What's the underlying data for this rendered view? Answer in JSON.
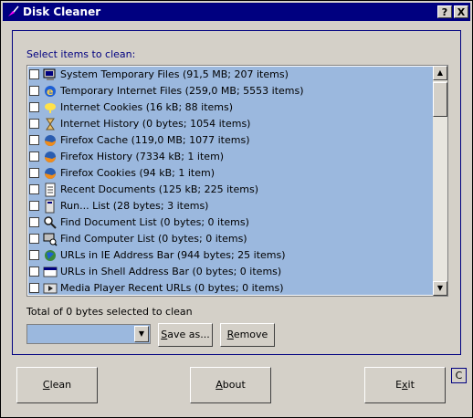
{
  "window": {
    "title": "Disk Cleaner",
    "help_button": "?",
    "close_button": "X"
  },
  "list_label": "Select items to clean:",
  "items": [
    {
      "label": "System Temporary Files (91,5 MB; 207 items)",
      "icon": "computer-icon"
    },
    {
      "label": "Temporary Internet Files (259,0 MB; 5553 items)",
      "icon": "internet-explorer-icon"
    },
    {
      "label": "Internet Cookies (16 kB; 88 items)",
      "icon": "cookie-icon"
    },
    {
      "label": "Internet History (0 bytes; 1054 items)",
      "icon": "hourglass-icon"
    },
    {
      "label": "Firefox Cache (119,0 MB; 1077 items)",
      "icon": "firefox-icon"
    },
    {
      "label": "Firefox History (7334 kB; 1 item)",
      "icon": "firefox-icon"
    },
    {
      "label": "Firefox Cookies (94 kB; 1 item)",
      "icon": "firefox-icon"
    },
    {
      "label": "Recent Documents (125 kB; 225 items)",
      "icon": "document-icon"
    },
    {
      "label": "Run... List (28 bytes; 3 items)",
      "icon": "run-icon"
    },
    {
      "label": "Find Document List (0 bytes; 0 items)",
      "icon": "magnifier-icon"
    },
    {
      "label": "Find Computer List (0 bytes; 0 items)",
      "icon": "find-computer-icon"
    },
    {
      "label": "URLs in IE Address Bar (944 bytes; 25 items)",
      "icon": "globe-icon"
    },
    {
      "label": "URLs in Shell Address Bar (0 bytes; 0 items)",
      "icon": "address-bar-icon"
    },
    {
      "label": "Media Player Recent URLs (0 bytes; 0 items)",
      "icon": "media-player-icon"
    }
  ],
  "total_text": "Total of 0 bytes selected to clean",
  "profile_combo_value": "",
  "save_as": {
    "underlined": "S",
    "rest": "ave as..."
  },
  "remove": {
    "underlined": "R",
    "rest": "emove"
  },
  "clean": {
    "underlined": "C",
    "rest": "lean"
  },
  "about": {
    "underlined": "A",
    "rest": "bout"
  },
  "exit": {
    "before": "E",
    "underlined": "x",
    "rest": "it"
  },
  "corner_button": "C",
  "colors": {
    "title_bar": "#000080",
    "list_selection": "#9bb8de",
    "face": "#d4d0c8"
  }
}
